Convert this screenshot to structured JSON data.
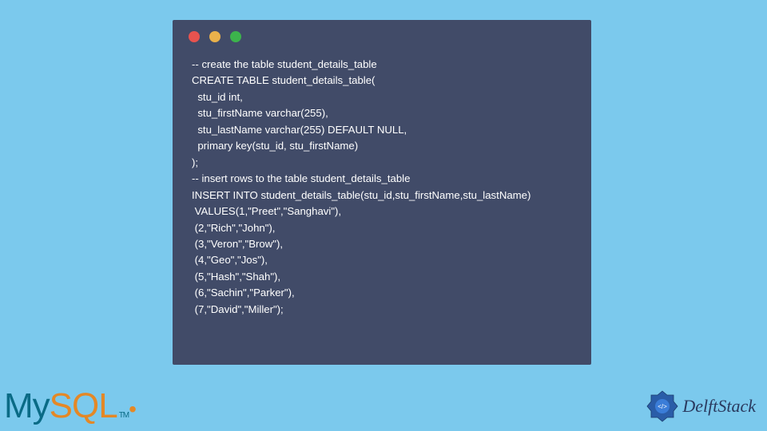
{
  "code": {
    "line1": "-- create the table student_details_table",
    "line2": "CREATE TABLE student_details_table(",
    "line3": "  stu_id int,",
    "line4": "  stu_firstName varchar(255),",
    "line5": "  stu_lastName varchar(255) DEFAULT NULL,",
    "line6": "  primary key(stu_id, stu_firstName)",
    "line7": ");",
    "line8": "-- insert rows to the table student_details_table",
    "line9": "INSERT INTO student_details_table(stu_id,stu_firstName,stu_lastName)",
    "line10": " VALUES(1,\"Preet\",\"Sanghavi\"),",
    "line11": " (2,\"Rich\",\"John\"),",
    "line12": " (3,\"Veron\",\"Brow\"),",
    "line13": " (4,\"Geo\",\"Jos\"),",
    "line14": " (5,\"Hash\",\"Shah\"),",
    "line15": " (6,\"Sachin\",\"Parker\"),",
    "line16": " (7,\"David\",\"Miller\");"
  },
  "logos": {
    "mysql_my": "My",
    "mysql_sql": "SQL",
    "mysql_tm": "TM",
    "mysql_dot": "•",
    "delft": "DelftStack"
  }
}
